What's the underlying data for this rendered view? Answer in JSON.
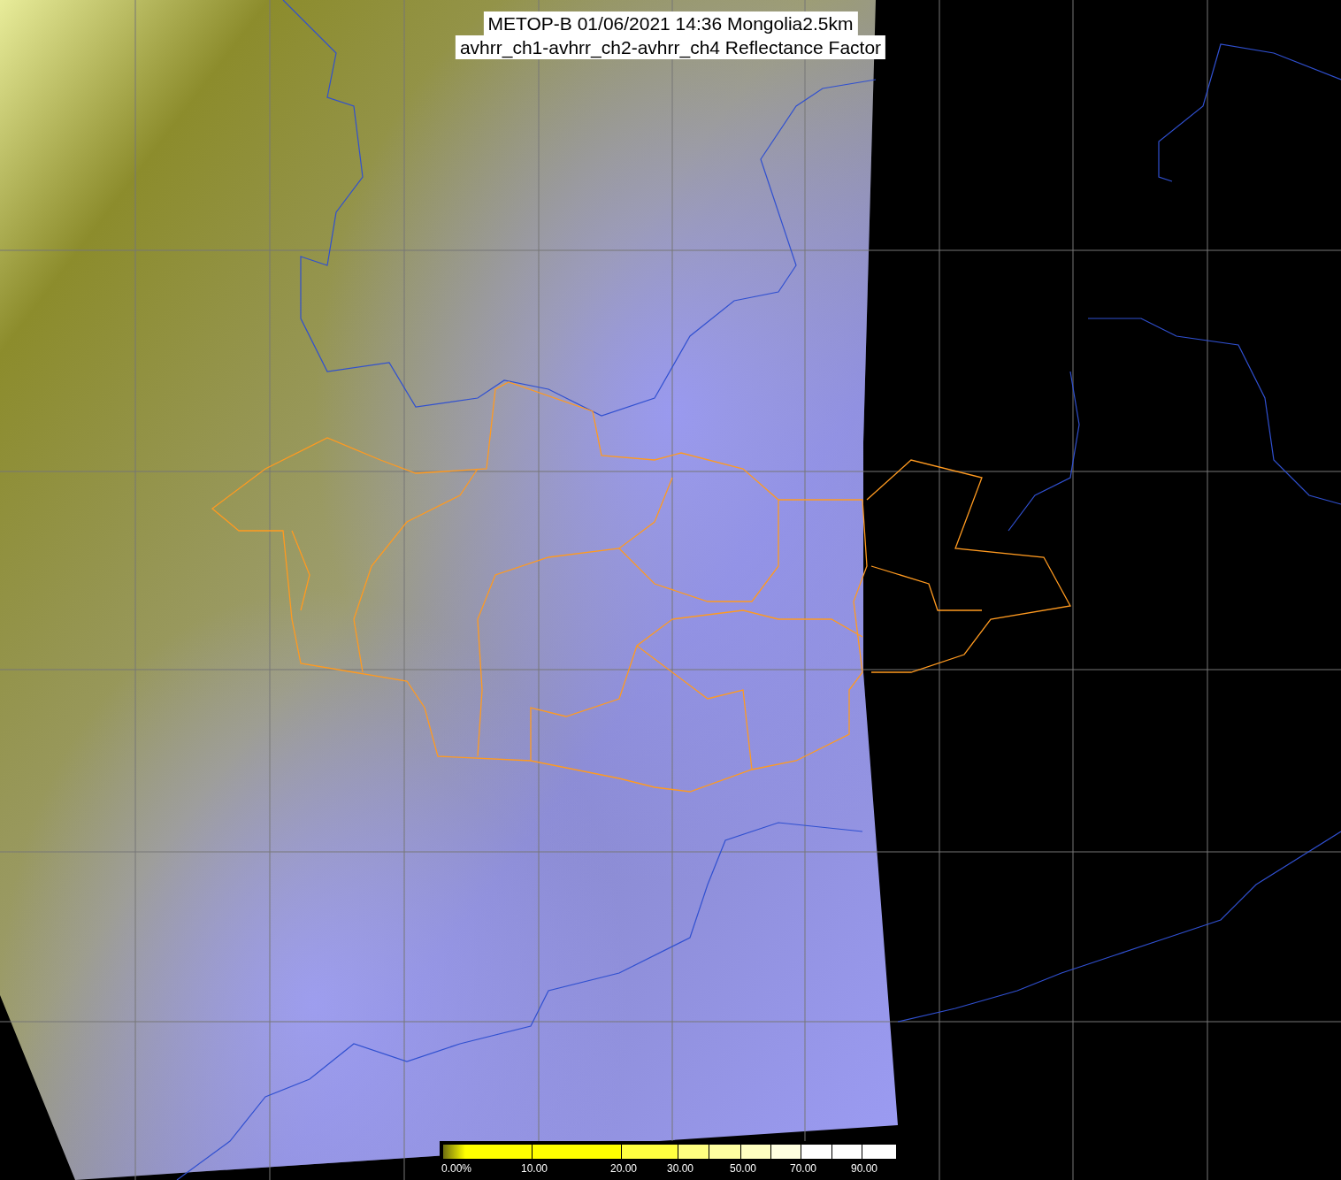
{
  "title_lines": [
    "METOP-B 01/06/2021 14:36 Mongolia2.5km",
    "avhrr_ch1-avhrr_ch2-avhrr_ch4 Reflectance Factor"
  ],
  "legend": {
    "ticks": [
      "0.00%",
      "10.00",
      "20.00",
      "30.00",
      "50.00",
      "70.00",
      "90.00"
    ]
  }
}
